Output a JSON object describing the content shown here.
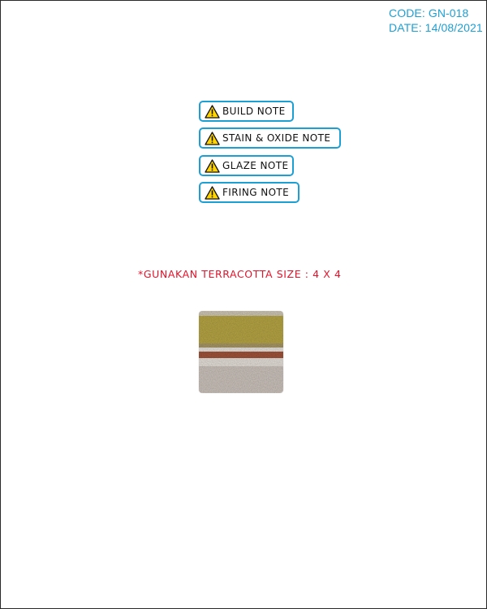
{
  "header": {
    "code": "CODE: GN-018",
    "date": "DATE: 14/08/2021"
  },
  "notes": {
    "build_label": "BUILD NOTE",
    "stain_label": "STAIN & OXIDE NOTE",
    "glaze_label": "GLAZE NOTE",
    "firing_label": "FIRING NOTE",
    "icon": "warning-triangle-icon"
  },
  "instruction": "*GUNAKAN TERRACOTTA SIZE : 4 X 4",
  "colors": {
    "accent": "#1e9fd4",
    "instruction_red": "#e0142b",
    "warning_yellow": "#ffd400"
  }
}
